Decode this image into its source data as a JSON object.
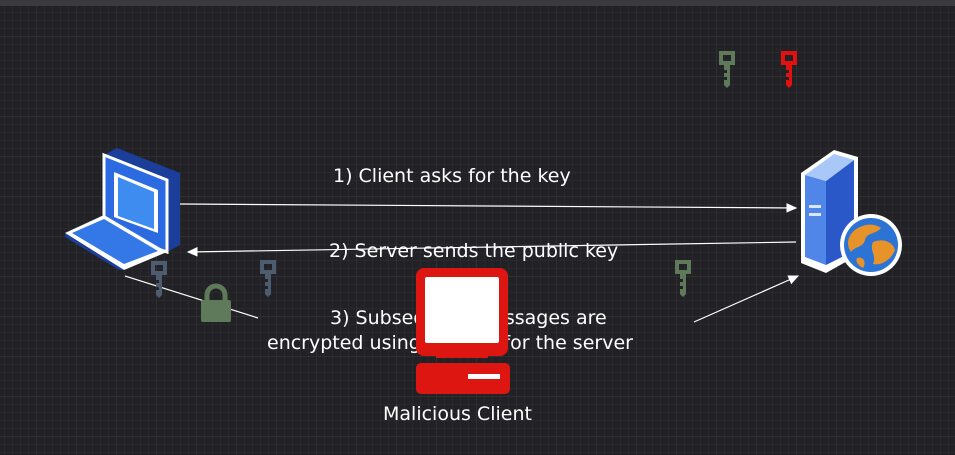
{
  "labels": {
    "step1": "1) Client asks for the key",
    "step2": "2) Server sends the public key",
    "step3_line1": "3) Subsequent messages are",
    "step3_line2": "encrypted using the key for the server",
    "malicious": "Malicious Client"
  },
  "colors": {
    "background": "#222226",
    "arrow": "#ffffff",
    "key_green": "#5f7a5a",
    "key_red": "#e0110f",
    "key_slate": "#4e5c70",
    "lock": "#5f7a5a",
    "malicious_pc": "#dd1611"
  },
  "icons": [
    "laptop-icon",
    "server-icon",
    "globe-icon",
    "key-icon",
    "lock-icon",
    "malicious-computer-icon"
  ]
}
